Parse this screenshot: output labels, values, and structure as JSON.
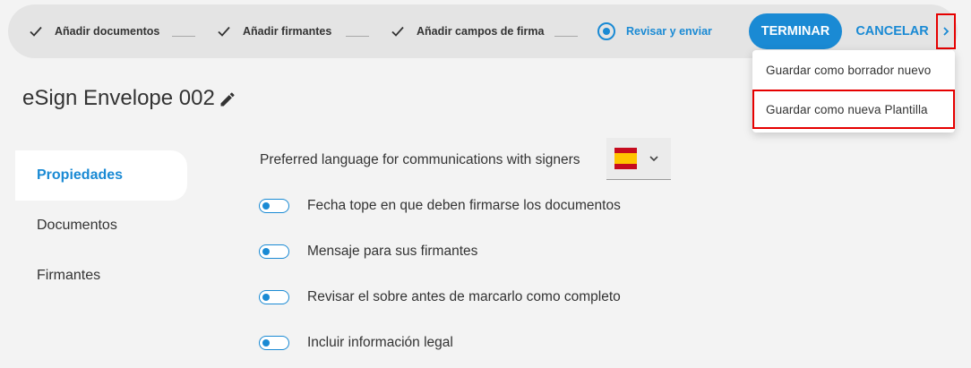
{
  "stepper": {
    "steps": [
      {
        "label": "Añadir documentos",
        "state": "done"
      },
      {
        "label": "Añadir firmantes",
        "state": "done"
      },
      {
        "label": "Añadir campos de firma",
        "state": "done"
      },
      {
        "label": "Revisar y enviar",
        "state": "active"
      }
    ],
    "finish_label": "TERMINAR",
    "cancel_label": "CANCELAR",
    "more_icon": "chevron-right-icon"
  },
  "menu": {
    "items": [
      {
        "label": "Guardar como borrador nuevo"
      },
      {
        "label": "Guardar como nueva Plantilla"
      }
    ]
  },
  "header": {
    "title": "eSign Envelope 002",
    "edit_icon": "pencil-icon"
  },
  "sidebar": {
    "items": [
      {
        "label": "Propiedades",
        "active": true
      },
      {
        "label": "Documentos",
        "active": false
      },
      {
        "label": "Firmantes",
        "active": false
      }
    ]
  },
  "settings": {
    "language_label": "Preferred language for communications with signers",
    "language_flag": "spain-flag-icon",
    "options": [
      {
        "label": "Fecha tope en que deben firmarse los documentos",
        "enabled": false
      },
      {
        "label": "Mensaje para sus firmantes",
        "enabled": false
      },
      {
        "label": "Revisar el sobre antes de marcarlo como completo",
        "enabled": false
      },
      {
        "label": "Incluir información legal",
        "enabled": false
      }
    ]
  },
  "colors": {
    "accent": "#1a8ad4",
    "highlight_border": "#e60000",
    "background": "#f3f3f3",
    "stepper_bg": "#e4e4e4"
  }
}
